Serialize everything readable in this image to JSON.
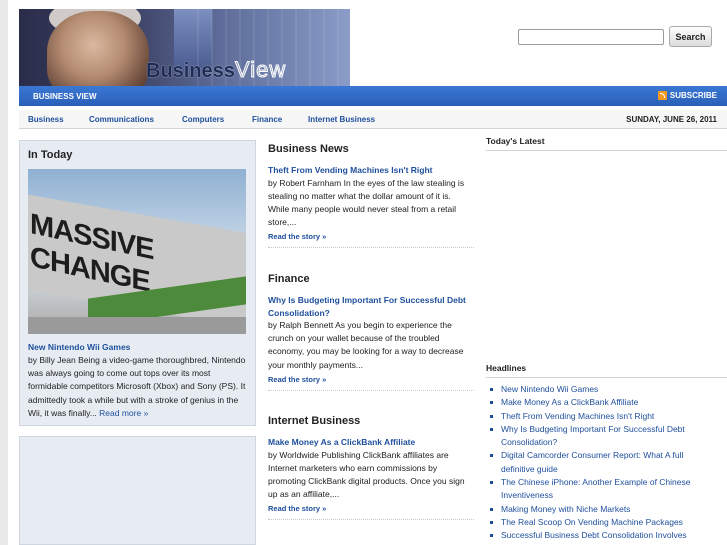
{
  "header": {
    "logo_word1": "Business",
    "logo_word2": "View",
    "search_placeholder": "",
    "search_button": "Search"
  },
  "navbar": {
    "brand": "BUSINESS VIEW",
    "subscribe": "SUBSCRIBE",
    "rss_icon": "rss-icon"
  },
  "categories": [
    "Business",
    "Communications",
    "Computers",
    "Finance",
    "Internet Business"
  ],
  "date": "SUNDAY, JUNE 26, 2011",
  "in_today": {
    "heading": "In Today",
    "image_text": "MASSIVE CHANGE",
    "title": "New Nintendo Wii Games",
    "excerpt": "by Billy Jean Being a video-game thoroughbred, Nintendo was always going to come out tops over its most formidable competitors Microsoft (Xbox) and Sony (PS). It admittedly took a while but with a stroke of genius in the Wii, it was finally...",
    "more": "Read more »"
  },
  "sections": [
    {
      "heading": "Business News",
      "story_title": "Theft From Vending Machines Isn't Right",
      "excerpt": "by Robert Farnham In the eyes of the law stealing is stealing no matter what the dollar amount of it is. While many people would never steal from a retail store,...",
      "more": "Read the story »"
    },
    {
      "heading": "Finance",
      "story_title": "Why Is Budgeting Important For Successful Debt Consolidation?",
      "excerpt": "by Ralph Bennett As you begin to experience the crunch on your wallet because of the troubled economy, you may be looking for a way to decrease your monthly payments...",
      "more": "Read the story »"
    },
    {
      "heading": "Internet Business",
      "story_title": "Make Money As a ClickBank Affiliate",
      "excerpt": "by Worldwide Publishing ClickBank affiliates are Internet marketers who earn commissions by promoting ClickBank digital products. Once you sign up as an affiliate,...",
      "more": "Read the story »"
    }
  ],
  "sidebar": {
    "latest_heading": "Today's Latest",
    "headlines_heading": "Headlines",
    "headlines": [
      "New Nintendo Wii Games",
      "Make Money As a ClickBank Affiliate",
      "Theft From Vending Machines Isn't Right",
      "Why Is Budgeting Important For Successful Debt Consolidation?",
      "Digital Camcorder Consumer Report: What A full definitive guide",
      "The Chinese iPhone: Another Example of Chinese Inventiveness",
      "Making Money with Niche Markets",
      "The Real Scoop On Vending Machine Packages",
      "Successful Business Debt Consolidation Involves"
    ]
  }
}
